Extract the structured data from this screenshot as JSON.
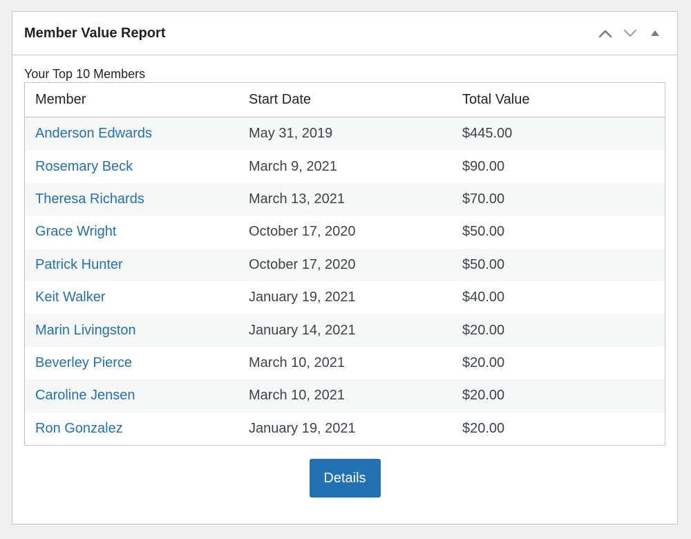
{
  "widget": {
    "title": "Member Value Report",
    "controls": {
      "up_icon": "chevron-up-icon",
      "down_icon": "chevron-down-icon",
      "toggle_icon": "triangle-up-icon"
    },
    "subtitle": "Your Top 10 Members"
  },
  "table": {
    "headers": {
      "member": "Member",
      "start_date": "Start Date",
      "total_value": "Total Value"
    },
    "rows": [
      {
        "member": "Anderson Edwards",
        "start_date": "May 31, 2019",
        "total_value": "$445.00"
      },
      {
        "member": "Rosemary Beck",
        "start_date": "March 9, 2021",
        "total_value": "$90.00"
      },
      {
        "member": "Theresa Richards",
        "start_date": "March 13, 2021",
        "total_value": "$70.00"
      },
      {
        "member": "Grace Wright",
        "start_date": "October 17, 2020",
        "total_value": "$50.00"
      },
      {
        "member": "Patrick Hunter",
        "start_date": "October 17, 2020",
        "total_value": "$50.00"
      },
      {
        "member": "Keit Walker",
        "start_date": "January 19, 2021",
        "total_value": "$40.00"
      },
      {
        "member": "Marin Livingston",
        "start_date": "January 14, 2021",
        "total_value": "$20.00"
      },
      {
        "member": "Beverley Pierce",
        "start_date": "March 10, 2021",
        "total_value": "$20.00"
      },
      {
        "member": "Caroline Jensen",
        "start_date": "March 10, 2021",
        "total_value": "$20.00"
      },
      {
        "member": "Ron Gonzalez",
        "start_date": "January 19, 2021",
        "total_value": "$20.00"
      }
    ]
  },
  "footer": {
    "details_label": "Details"
  },
  "colors": {
    "link": "#2271b1",
    "button_bg": "#2271b1",
    "stripe": "#f6f7f7",
    "border": "#c3c4c7",
    "page_bg": "#f0f0f1"
  }
}
